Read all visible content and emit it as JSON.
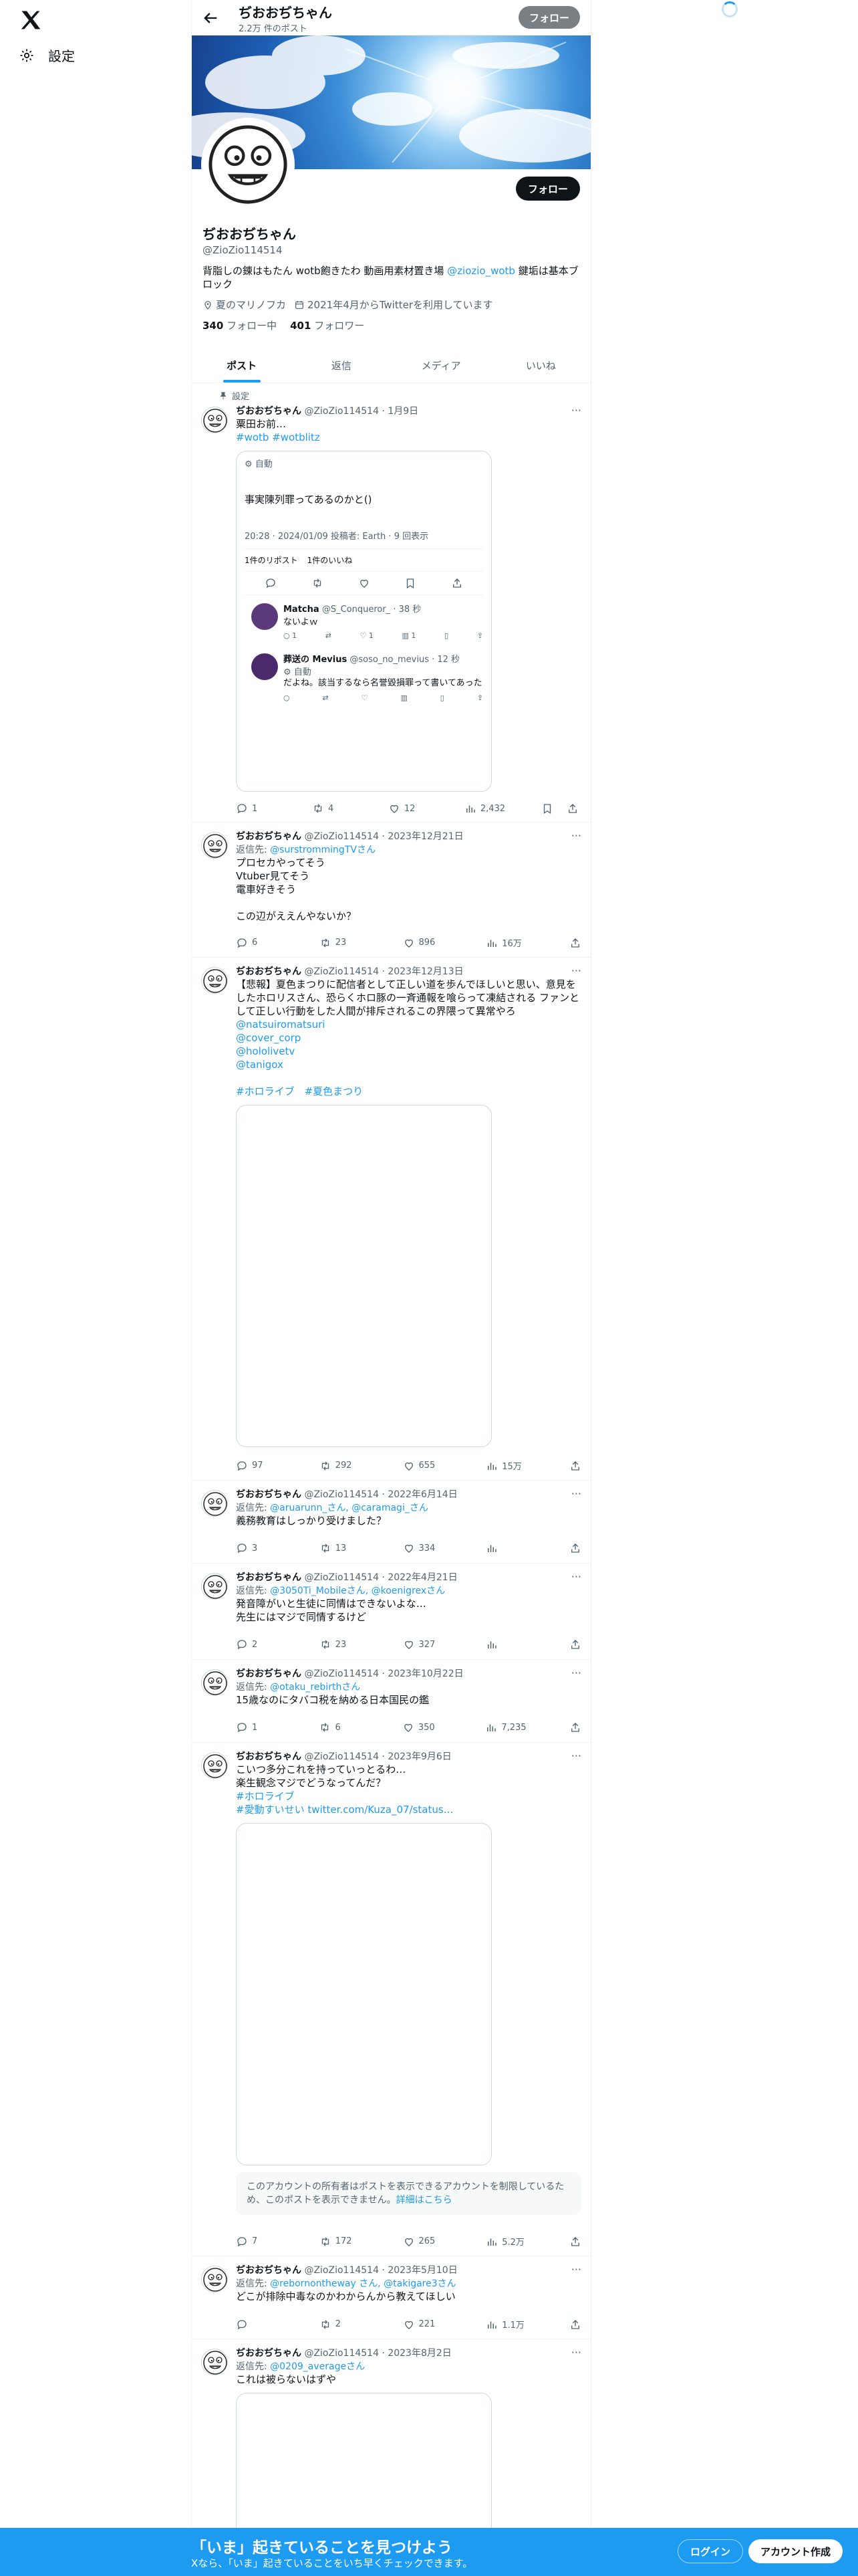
{
  "nav": {
    "settings_label": "設定"
  },
  "header": {
    "name": "ぢおおぢちゃん",
    "post_count": "2.2万 件のポスト",
    "follow_label": "フォロー"
  },
  "profile": {
    "name": "ぢおおぢちゃん",
    "handle": "@ZioZio114514",
    "bio_prefix": "背脂しの錬はもたん wotb飽きたわ 動画用素材置き場 ",
    "bio_link": "@ziozio_wotb",
    "bio_suffix": " 鍵垢は基本ブロック",
    "location": "夏のマリノフカ",
    "joined": "2021年4月からTwitterを利用しています",
    "following_count": "340",
    "following_label": "フォロー中",
    "followers_count": "401",
    "followers_label": "フォロワー",
    "follow_label": "フォロー"
  },
  "tabs": [
    "ポスト",
    "返信",
    "メディア",
    "いいね"
  ],
  "pinned_label": "設定",
  "tweets": [
    {
      "name": "ぢおおぢちゃん",
      "meta": "@ZioZio114514 · 1月9日",
      "text": "粟田お前…",
      "hashtags": "#wotb #wotblitz",
      "quote": {
        "auto": "自動",
        "text": "事実陳列罪ってあるのかと()",
        "meta": "20:28 · 2024/01/09 投稿者: Earth · 9 回表示",
        "reposts": "1件のリポスト",
        "likes": "1件のいいね",
        "reply1_name": "Matcha",
        "reply1_meta": "@S_Conqueror_ · 38 秒",
        "reply1_text": "ないよｗ",
        "reply2_name": "葬送の Mevius",
        "reply2_meta": "@soso_no_mevius · 12 秒",
        "reply2_auto": "自動",
        "reply2_text": "だよね。該当するなら名誉毀損罪って書いてあった"
      },
      "replies": "1",
      "retweets": "4",
      "likes": "12",
      "views": "2,432"
    },
    {
      "name": "ぢおおぢちゃん",
      "meta": "@ZioZio114514 · 2023年12月21日",
      "reply_to_prefix": "返信先: ",
      "reply_to": "@surstrommingTVさん",
      "text1": "プロセカやってそう",
      "text2": "Vtuber見てそう",
      "text3": "電車好きそう",
      "text4": "この辺がええんやないか？",
      "replies": "6",
      "retweets": "23",
      "likes": "896",
      "views": "16万"
    },
    {
      "name": "ぢおおぢちゃん",
      "meta": "@ZioZio114514 · 2023年12月13日",
      "text": "【悲報】夏色まつりに配信者として正しい道を歩んでほしいと思い、意見をしたホロリスさん、恐らくホロ豚の一斉通報を喰らって凍結される ファンとして正しい行動をした人間が排斥されるこの界隈って異常やろ",
      "m1": "@natsuiromatsuri",
      "m2": "@cover_corp",
      "m3": "@hololivetv",
      "m4": "@tanigox",
      "hashtags": "#ホロライブ　#夏色まつり",
      "replies": "97",
      "retweets": "292",
      "likes": "655",
      "views": "15万"
    },
    {
      "name": "ぢおおぢちゃん",
      "meta": "@ZioZio114514 · 2022年6月14日",
      "reply_to_prefix": "返信先: ",
      "reply_to": "@aruarunn_さん, @caramagi_さん",
      "text": "義務教育はしっかり受けました？",
      "replies": "3",
      "retweets": "13",
      "likes": "334",
      "views": ""
    },
    {
      "name": "ぢおおぢちゃん",
      "meta": "@ZioZio114514 · 2022年4月21日",
      "reply_to_prefix": "返信先: ",
      "reply_to": "@3050Ti_Mobileさん, @koenigrexさん",
      "text1": "発音障がいと生徒に同情はできないよな…",
      "text2": "先生にはマジで同情するけど",
      "replies": "2",
      "retweets": "23",
      "likes": "327",
      "views": ""
    },
    {
      "name": "ぢおおぢちゃん",
      "meta": "@ZioZio114514 · 2023年10月22日",
      "reply_to_prefix": "返信先: ",
      "reply_to": "@otaku_rebirthさん",
      "text": "15歳なのにタバコ税を納める日本国民の鑑",
      "replies": "1",
      "retweets": "6",
      "likes": "350",
      "views": "7,235"
    },
    {
      "name": "ぢおおぢちゃん",
      "meta": "@ZioZio114514 · 2023年9月6日",
      "text1": "こいつ多分これを持っていっとるわ…",
      "text2": "楽生観念マジでどうなってんだ？",
      "hashtag1": "#ホロライブ",
      "hashtag2": "#愛動すいせい twitter.com/Kuza_07/status…",
      "notice": "このアカウントの所有者はポストを表示できるアカウントを制限しているため、このポストを表示できません。",
      "notice_link": "詳細はこちら",
      "replies": "7",
      "retweets": "172",
      "likes": "265",
      "views": "5.2万"
    },
    {
      "name": "ぢおおぢちゃん",
      "meta": "@ZioZio114514 · 2023年5月10日",
      "reply_to_prefix": "返信先: ",
      "reply_to": "@rebornontheway さん, @takigare3さん",
      "text": "どこが排除中毒なのかわからんから教えてほしい",
      "replies": "",
      "retweets": "2",
      "likes": "221",
      "views": "1.1万"
    },
    {
      "name": "ぢおおぢちゃん",
      "meta": "@ZioZio114514 · 2023年8月2日",
      "reply_to_prefix": "返信先: ",
      "reply_to": "@0209_averageさん",
      "text": "これは被らないはずや"
    }
  ],
  "bottom_bar": {
    "title": "「いま」起きていることを見つけよう",
    "subtitle": "Xなら、「いま」起きていることをいち早くチェックできます。",
    "login": "ログイン",
    "signup": "アカウント作成"
  }
}
